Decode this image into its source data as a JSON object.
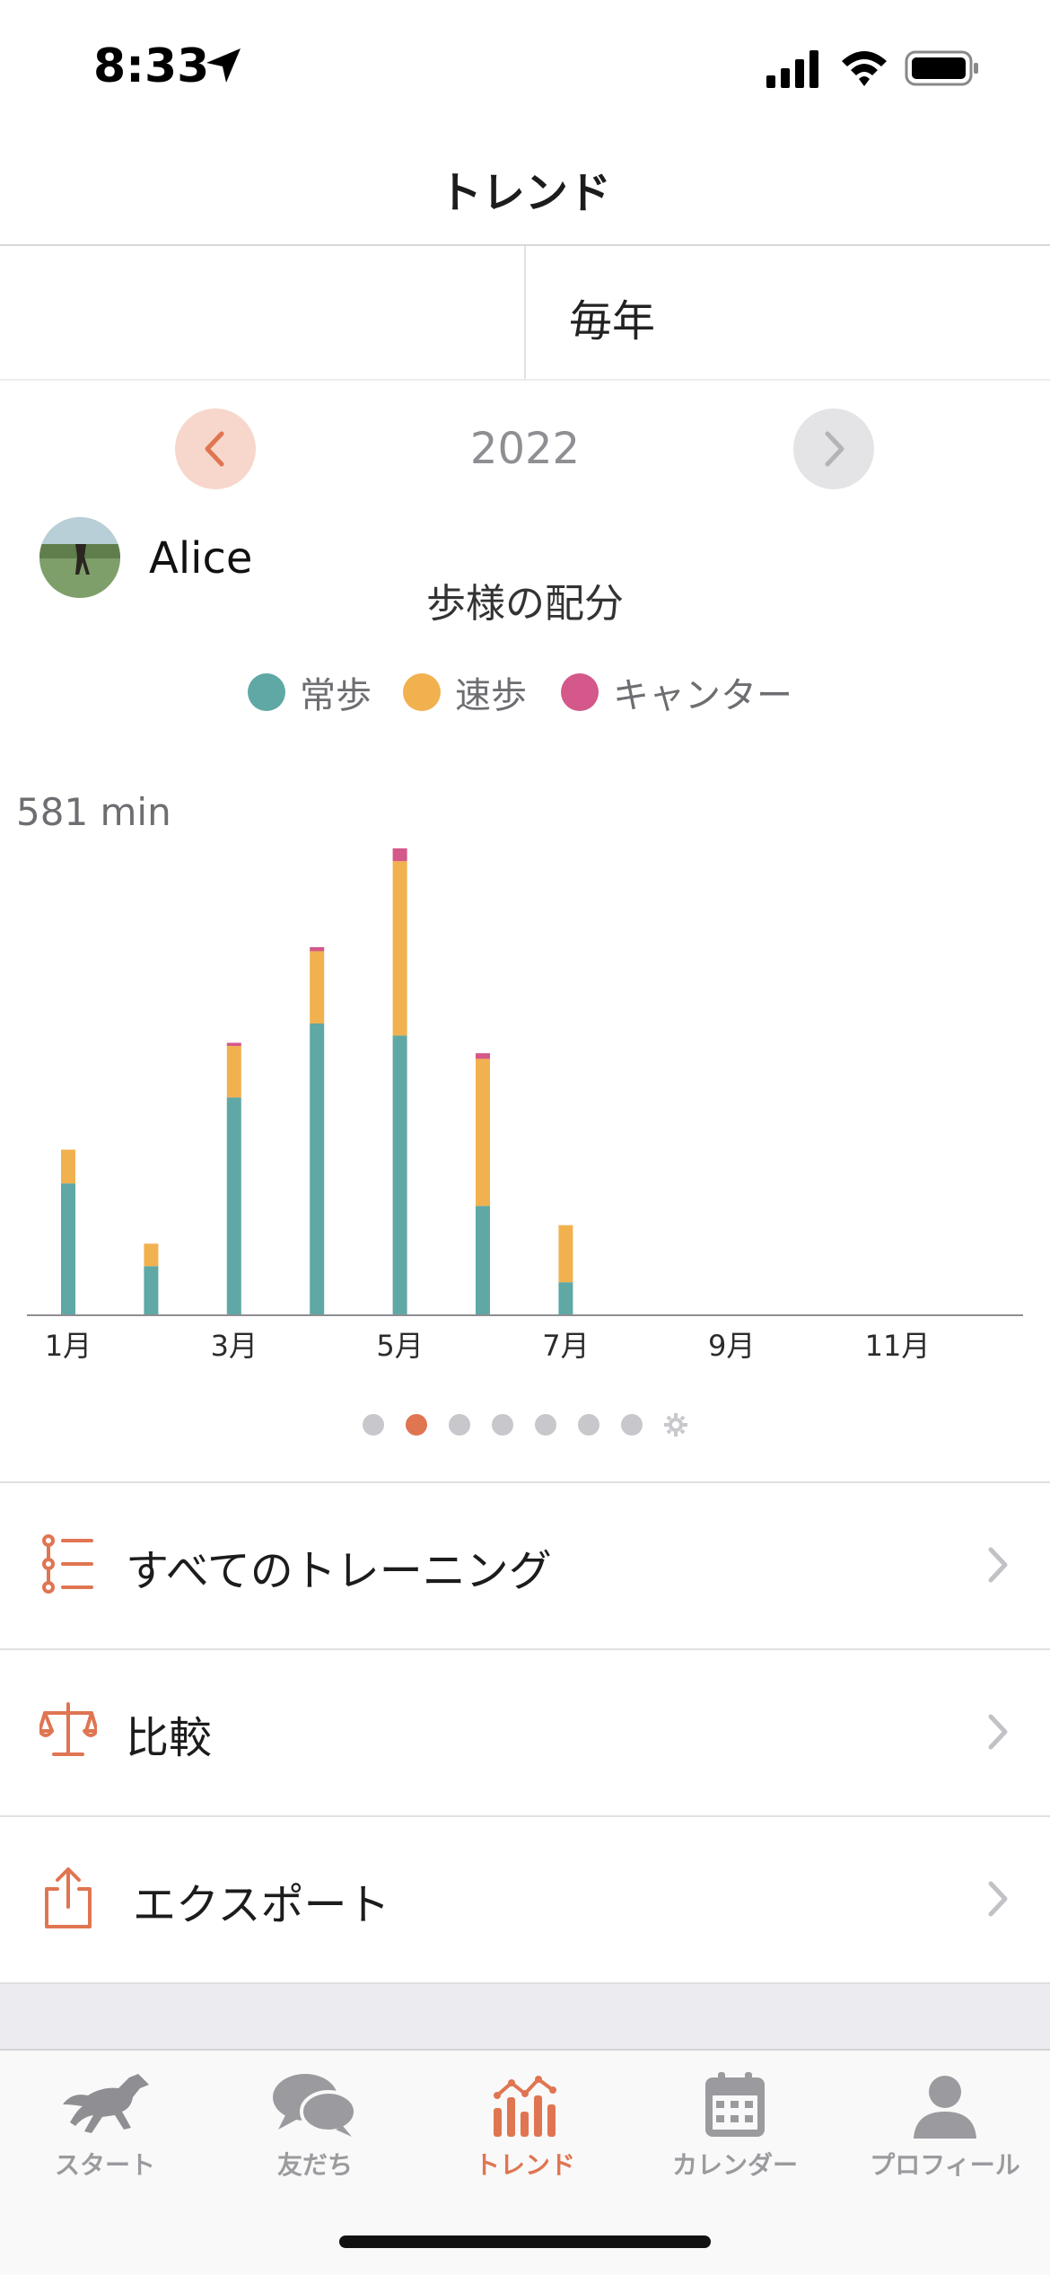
{
  "status_bar": {
    "time": "8:33"
  },
  "nav": {
    "title": "トレンド"
  },
  "selector": {
    "user_name": "Alice",
    "period": "毎年"
  },
  "year_nav": {
    "year": "2022"
  },
  "chart_data": {
    "type": "bar",
    "title": "歩様の配分",
    "stacked": true,
    "max_label": "581 min",
    "ylim": [
      0,
      581
    ],
    "categories": [
      "1月",
      "2月",
      "3月",
      "4月",
      "5月",
      "6月",
      "7月",
      "8月",
      "9月",
      "10月",
      "11月",
      "12月"
    ],
    "tick_labels": [
      "1月",
      "3月",
      "5月",
      "7月",
      "9月",
      "11月"
    ],
    "series": [
      {
        "name": "常歩",
        "color": "#5fa8a5",
        "values": [
          163,
          60,
          270,
          362,
          347,
          135,
          40,
          0,
          0,
          0,
          0,
          0
        ]
      },
      {
        "name": "速歩",
        "color": "#f2b14f",
        "values": [
          42,
          28,
          64,
          90,
          217,
          183,
          71,
          0,
          0,
          0,
          0,
          0
        ]
      },
      {
        "name": "キャンター",
        "color": "#d4588a",
        "values": [
          0,
          0,
          4,
          5,
          16,
          7,
          0,
          0,
          0,
          0,
          0,
          0
        ]
      }
    ]
  },
  "pagination": {
    "count": 7,
    "active": 1
  },
  "menu": {
    "all_training": "すべてのトレーニング",
    "compare": "比較",
    "export": "エクスポート"
  },
  "tabs": [
    {
      "label": "スタート"
    },
    {
      "label": "友だち"
    },
    {
      "label": "トレンド"
    },
    {
      "label": "カレンダー"
    },
    {
      "label": "プロフィール"
    }
  ],
  "colors": {
    "accent": "#e07552",
    "inactive": "#9b9b9f"
  }
}
